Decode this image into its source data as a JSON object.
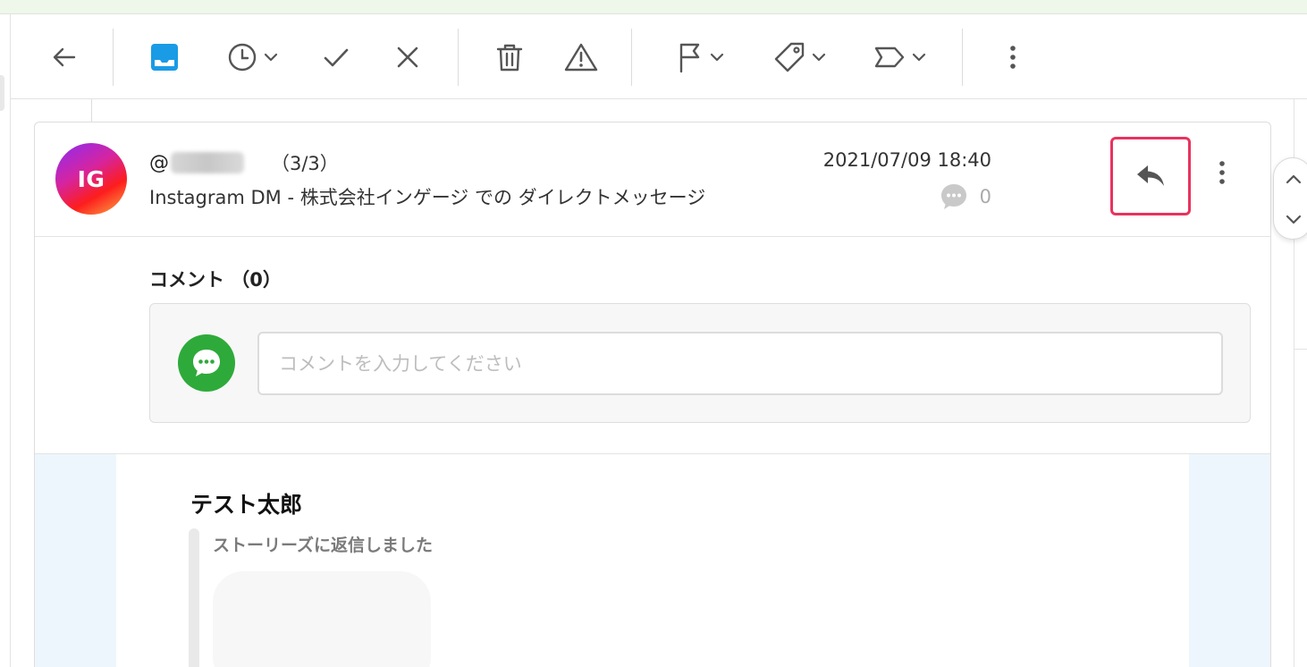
{
  "message": {
    "avatar_initials": "IG",
    "sender_prefix": "@",
    "thread_count": "（3/3）",
    "subject": "Instagram DM  -  株式会社インゲージ での ダイレクトメッセージ",
    "date": "2021/07/09 18:40",
    "comment_count": "0"
  },
  "comments": {
    "title": "コメント （0）",
    "placeholder": "コメントを入力してください"
  },
  "body": {
    "sender_name": "テスト太郎",
    "note": "ストーリーズに返信しました"
  },
  "colors": {
    "highlight": "#e8335f",
    "inbox_blue": "#1a9be6",
    "comment_green": "#2eaa3a"
  },
  "icons": [
    "back-arrow-icon",
    "inbox-icon",
    "clock-icon",
    "check-icon",
    "close-icon",
    "trash-icon",
    "warning-icon",
    "flag-icon",
    "tag-icon",
    "label-icon",
    "more-vertical-icon",
    "reply-icon",
    "comment-bubble-icon",
    "chevron-up-icon",
    "chevron-down-icon"
  ]
}
